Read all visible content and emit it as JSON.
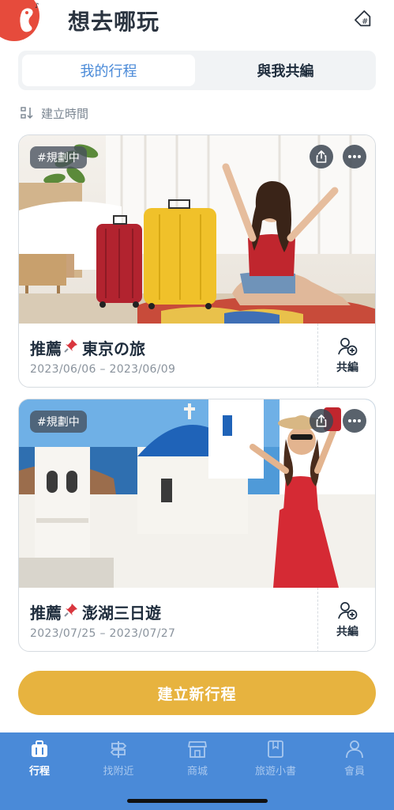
{
  "header": {
    "title": "想去哪玩"
  },
  "tabs": [
    {
      "label": "我的行程",
      "active": true
    },
    {
      "label": "與我共編",
      "active": false
    }
  ],
  "sort": {
    "label": "建立時間"
  },
  "trips": [
    {
      "badge": "#規劃中",
      "title": "推薦📌東京の旅",
      "title_prefix": "推薦",
      "title_name": "東京の旅",
      "dates": "2023/06/06 – 2023/06/09",
      "co_edit_label": "共編",
      "photo": "woman-with-luggage-photo"
    },
    {
      "badge": "#規劃中",
      "title": "推薦📌澎湖三日遊",
      "title_prefix": "推薦",
      "title_name": "澎湖三日遊",
      "dates": "2023/07/25 – 2023/07/27",
      "co_edit_label": "共編",
      "photo": "woman-santorini-photo"
    }
  ],
  "create_button": {
    "label": "建立新行程"
  },
  "tabbar": [
    {
      "label": "行程",
      "icon": "suitcase-icon",
      "active": true
    },
    {
      "label": "找附近",
      "icon": "signpost-icon",
      "active": false
    },
    {
      "label": "商城",
      "icon": "store-icon",
      "active": false
    },
    {
      "label": "旅遊小書",
      "icon": "book-icon",
      "active": false
    },
    {
      "label": "會員",
      "icon": "person-icon",
      "active": false
    }
  ],
  "colors": {
    "accent_blue": "#4a8ad8",
    "button_yellow": "#e7b33f",
    "logo_red": "#e64b3c",
    "title_dark": "#2b3440"
  }
}
